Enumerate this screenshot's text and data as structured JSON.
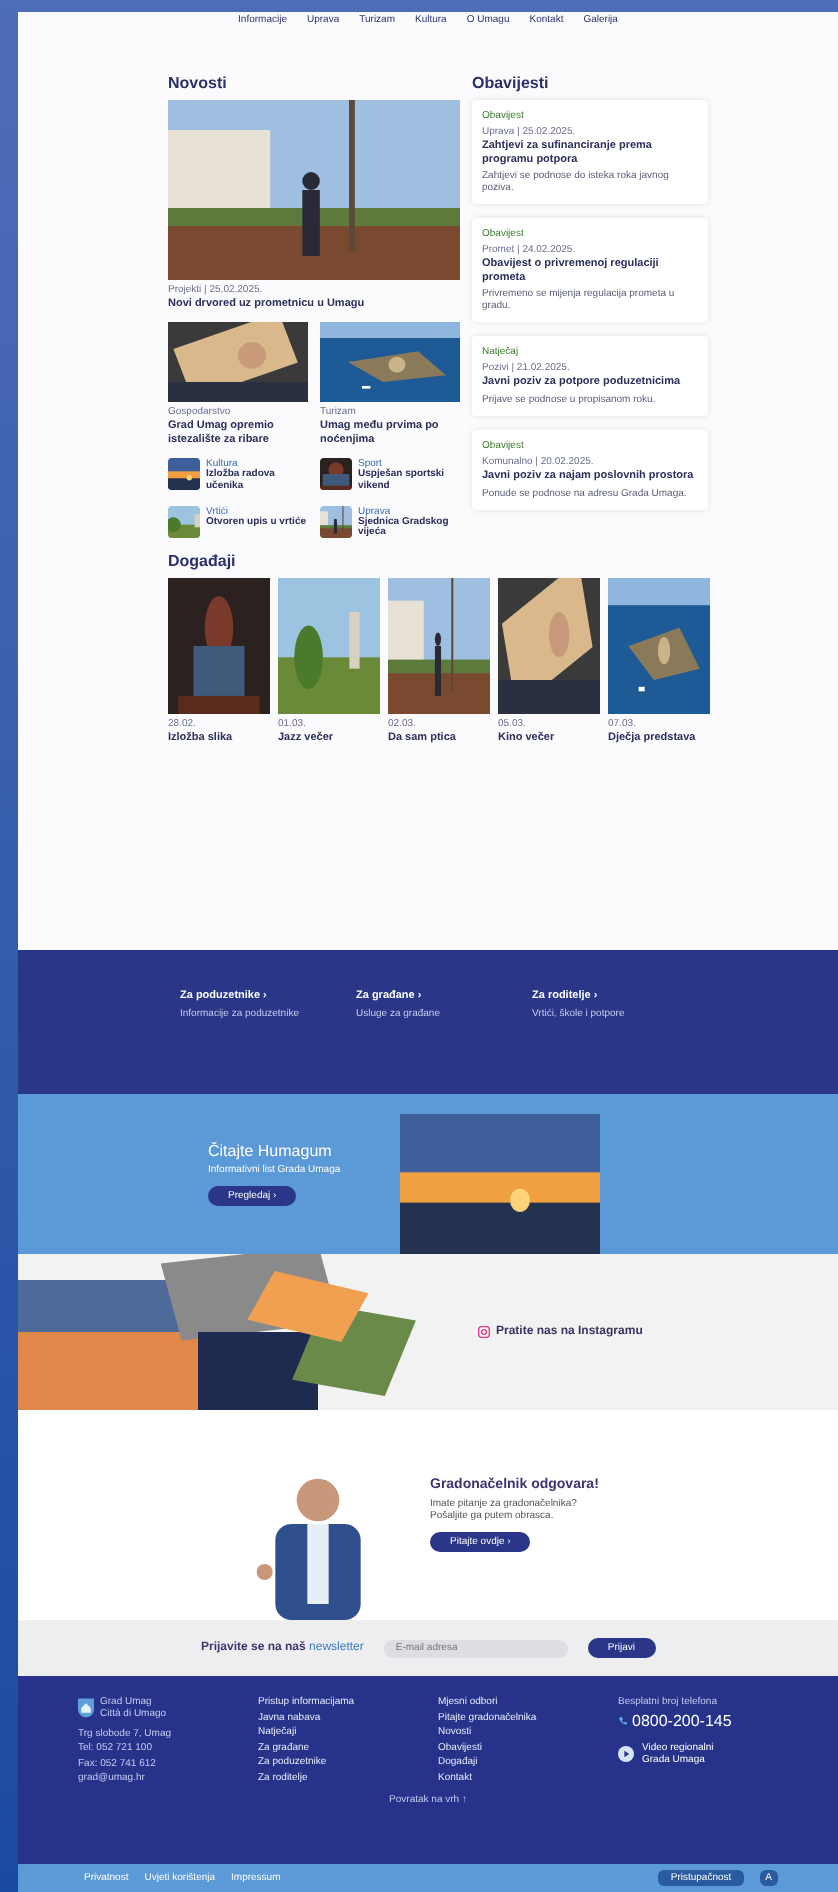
{
  "nav": [
    "Informacije",
    "Uprava",
    "Turizam",
    "Kultura",
    "O Umagu",
    "Kontakt",
    "Galerija"
  ],
  "news": {
    "title": "Novosti",
    "main": {
      "meta": "Projekti | 25.02.2025.",
      "title": "Novi drvored uz prometnicu u Umagu"
    },
    "mid": [
      {
        "meta": "Gospodarstvo",
        "title": "Grad Umag opremio istezalište za ribare"
      },
      {
        "meta": "Turizam",
        "title": "Umag među prvima po noćenjima"
      }
    ],
    "small": [
      {
        "category": "Kultura",
        "title": "Izložba radova učenika"
      },
      {
        "category": "Sport",
        "title": "Uspješan sportski vikend"
      },
      {
        "category": "Vrtići",
        "title": "Otvoren upis u vrtiće"
      },
      {
        "category": "Uprava",
        "title": "Sjednica Gradskog vijeća"
      }
    ]
  },
  "notices": {
    "title": "Obavijesti",
    "items": [
      {
        "tag": "Obavijest",
        "meta": "Uprava | 25.02.2025.",
        "title": "Zahtjevi za sufinanciranje prema programu potpora",
        "excerpt": "Zahtjevi se podnose do isteka roka javnog poziva."
      },
      {
        "tag": "Obavijest",
        "meta": "Promet | 24.02.2025.",
        "title": "Obavijest o privremenoj regulaciji prometa",
        "excerpt": "Privremeno se mijenja regulacija prometa u gradu."
      },
      {
        "tag": "Natječaj",
        "meta": "Pozivi | 21.02.2025.",
        "title": "Javni poziv za potpore poduzetnicima",
        "excerpt": "Prijave se podnose u propisanom roku."
      },
      {
        "tag": "Obavijest",
        "meta": "Komunalno | 20.02.2025.",
        "title": "Javni poziv za najam poslovnih prostora",
        "excerpt": "Ponude se podnose na adresu Grada Umaga."
      }
    ]
  },
  "events": {
    "title": "Događaji",
    "items": [
      {
        "meta": "28.02.",
        "title": "Izložba slika"
      },
      {
        "meta": "01.03.",
        "title": "Jazz večer"
      },
      {
        "meta": "02.03.",
        "title": "Da sam ptica"
      },
      {
        "meta": "05.03.",
        "title": "Kino večer"
      },
      {
        "meta": "07.03.",
        "title": "Dječja predstava"
      }
    ]
  },
  "audiences": [
    {
      "title": "Za poduzetnike ›",
      "text": "Informacije za poduzetnike"
    },
    {
      "title": "Za građane ›",
      "text": "Usluge za građane"
    },
    {
      "title": "Za roditelje ›",
      "text": "Vrtići, škole i potpore"
    }
  ],
  "magazine": {
    "title": "Čitajte Humagum",
    "subtitle": "Informativni list Grada Umaga",
    "button": "Pregledaj ›"
  },
  "instagram": {
    "text": "Pratite nas na Instagramu"
  },
  "mayor": {
    "title": "Gradonačelnik odgovara!",
    "text": "Imate pitanje za gradonačelnika? Pošaljite ga putem obrasca.",
    "button": "Pitajte ovdje ›"
  },
  "newsletter": {
    "text": "Prijavite se na naš **newsletter**",
    "placeholder": "E-mail adresa",
    "button": "Prijavi"
  },
  "footer": {
    "brand": [
      "Grad Umag",
      "Città di Umago"
    ],
    "address": [
      "Trg slobode 7, Umag",
      "Tel: 052 721 100",
      "Fax: 052 741 612",
      "grad@umag.hr"
    ],
    "links": [
      [
        "Pristup informacijama",
        "Javna nabava",
        "Natječaji",
        "Za građane",
        "Za poduzetnike",
        "Za roditelje"
      ],
      [
        "Mjesni odbori",
        "Pitajte gradonačelnika",
        "Novosti",
        "Obavijesti",
        "Događaji",
        "Kontakt"
      ]
    ],
    "hotline_label": "Besplatni broj telefona",
    "phone": "0800-200-145",
    "video": [
      "Video regionalni",
      "Grada Umaga"
    ],
    "top": "Povratak na vrh ↑",
    "bottom_links": [
      "Privatnost",
      "Uvjeti korištenja",
      "Impressum"
    ],
    "access": "Pristupačnost",
    "access_icon": "A"
  }
}
